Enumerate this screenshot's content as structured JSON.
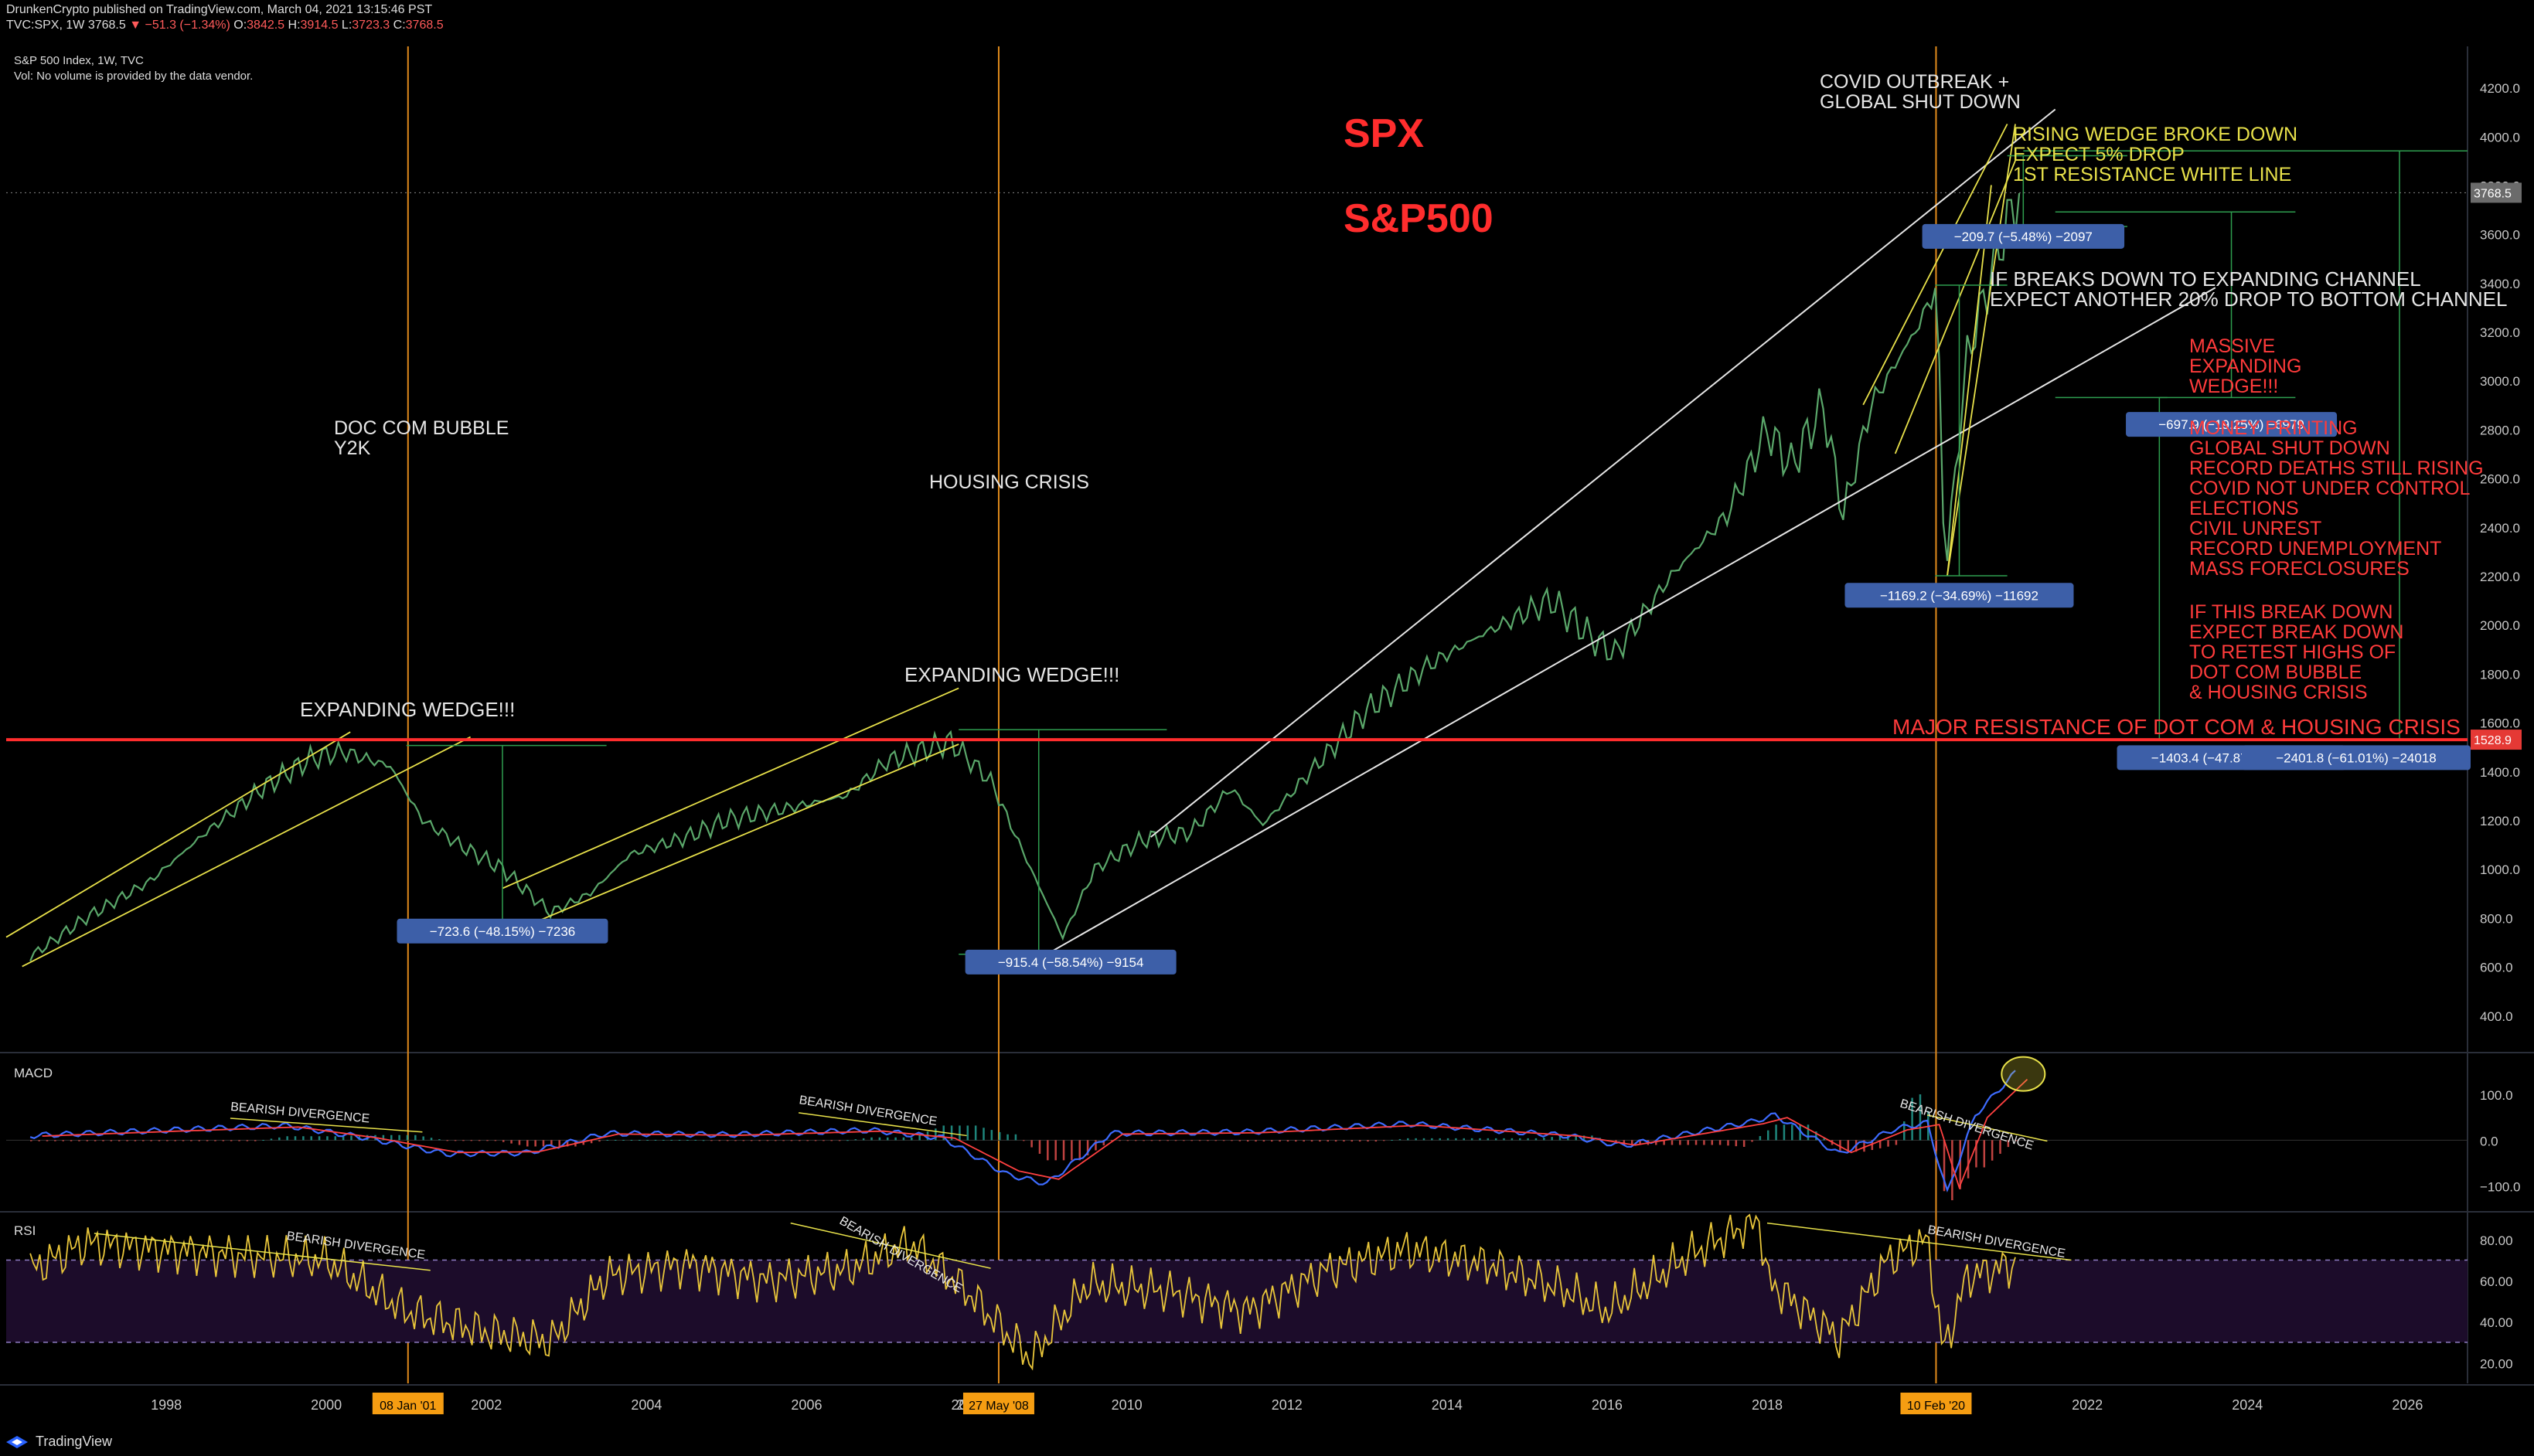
{
  "header": {
    "published": "DrunkenCrypto published on TradingView.com, March 04, 2021 13:15:46 PST",
    "symbol": "TVC:SPX, 1W",
    "last": "3768.5",
    "change": "−51.3 (−1.34%)",
    "o_label": "O:",
    "o": "3842.5",
    "h_label": "H:",
    "h": "3914.5",
    "l_label": "L:",
    "l": "3723.3",
    "c_label": "C:",
    "c": "3768.5",
    "index_title": "S&P 500 Index, 1W, TVC",
    "vol_note": "Vol: No volume is provided by the data vendor."
  },
  "footer": {
    "brand": "TradingView"
  },
  "colors": {
    "background": "#000000",
    "white": "#e6e6e6",
    "yellow": "#e8e14a",
    "red": "#ff2d2d",
    "orange": "#e08a1c",
    "green": "#2e9e4f",
    "macd": "#3d6bff",
    "signal": "#ff4040",
    "rsi": "#e8c53a",
    "label_bg": "#3d5fa8"
  },
  "chart_data": [
    {
      "type": "line",
      "panel": "price",
      "series": [
        {
          "x": [
            1996.3,
            1997.0,
            1997.8,
            1998.5,
            1999.2,
            1999.8,
            2000.2,
            2000.8,
            2001.2,
            2001.7,
            2002.2,
            2002.8,
            2003.3,
            2003.8,
            2004.5,
            2005.0,
            2005.8,
            2006.5,
            2007.0,
            2007.8,
            2008.3,
            2008.8,
            2009.2,
            2009.6,
            2010.2,
            2010.8,
            2011.3,
            2011.7,
            2012.3,
            2013.0,
            2013.8,
            2014.5,
            2015.3,
            2015.8,
            2016.1,
            2016.8,
            2017.5,
            2018.0,
            2018.3,
            2018.7,
            2018.95,
            2019.3,
            2019.9,
            2020.12,
            2020.22,
            2020.5,
            2020.9,
            2021.15
          ],
          "values": [
            640,
            800,
            950,
            1150,
            1330,
            1450,
            1480,
            1420,
            1200,
            1090,
            1000,
            820,
            900,
            1060,
            1130,
            1200,
            1250,
            1300,
            1440,
            1520,
            1360,
            1000,
            720,
            1000,
            1120,
            1150,
            1330,
            1180,
            1400,
            1650,
            1840,
            1970,
            2100,
            1950,
            1880,
            2200,
            2450,
            2800,
            2650,
            2900,
            2450,
            2900,
            3230,
            3390,
            2200,
            3100,
            3550,
            3768.5
          ]
        }
      ],
      "xlim": [
        1996.0,
        2026.75
      ],
      "ylim": [
        260,
        4330
      ],
      "x_ticks": [
        "1998",
        "2000",
        "2002",
        "2004",
        "2006",
        "2008",
        "2010",
        "2012",
        "2014",
        "2016",
        "2018",
        "2020",
        "2022",
        "2024",
        "2026"
      ],
      "x_tick_values": [
        1998,
        2000,
        2002,
        2004,
        2006,
        2008,
        2010,
        2012,
        2014,
        2016,
        2018,
        2020,
        2022,
        2024,
        2026
      ],
      "y_ticks": [
        "400.0",
        "600.0",
        "800.0",
        "1000.0",
        "1200.0",
        "1400.0",
        "1600.0",
        "1800.0",
        "2000.0",
        "2200.0",
        "2400.0",
        "2600.0",
        "2800.0",
        "3000.0",
        "3200.0",
        "3400.0",
        "3600.0",
        "3800.0",
        "4000.0",
        "4200.0"
      ],
      "y_tick_values": [
        400,
        600,
        800,
        1000,
        1200,
        1400,
        1600,
        1800,
        2000,
        2200,
        2400,
        2600,
        2800,
        3000,
        3200,
        3400,
        3600,
        3800,
        4000,
        4200
      ],
      "last_price_label": "3768.5",
      "resistance_price_label": "1528.9",
      "resistance_level": 1528.9,
      "event_lines": [
        {
          "x": 2001.02,
          "label": "08 Jan '01"
        },
        {
          "x": 2008.4,
          "label": "27 May '08"
        },
        {
          "x": 2020.11,
          "label": "10 Feb '20"
        }
      ],
      "x_edge_label": "2",
      "range_labels": [
        {
          "text": "−723.6 (−48.15%) −7236",
          "x": 2002.2,
          "y": 745
        },
        {
          "text": "−915.4 (−58.54%) −9154",
          "x": 2009.3,
          "y": 618
        },
        {
          "text": "−1169.2 (−34.69%) −11692",
          "x": 2020.4,
          "y": 2120
        },
        {
          "text": "−209.7 (−5.48%) −2097",
          "x": 2021.2,
          "y": 3590
        },
        {
          "text": "−697.9 (−19.25%) −6979",
          "x": 2023.8,
          "y": 2820
        },
        {
          "text": "−1403.4 (−47.87%) −14034",
          "x": 2023.8,
          "y": 1455
        },
        {
          "text": "−2401.8 (−61.01%) −24018",
          "x": 2026.8,
          "y": 1455
        }
      ],
      "annotations": {
        "spx": "SPX",
        "sp500": "S&P500",
        "dotcom_1": "DOC COM BUBBLE",
        "dotcom_2": "Y2K",
        "housing": "HOUSING CRISIS",
        "wedge_left": "EXPANDING WEDGE!!!",
        "wedge_mid": "EXPANDING WEDGE!!!",
        "covid_1": "COVID OUTBREAK +",
        "covid_2": "GLOBAL SHUT DOWN",
        "rising_1": "RISING WEDGE BROKE DOWN",
        "rising_2": "EXPECT 5% DROP",
        "rising_3": "1ST RESISTANCE WHITE LINE",
        "breaks_1": "IF BREAKS DOWN TO EXPANDING CHANNEL",
        "breaks_2": "EXPECT ANOTHER 20% DROP TO BOTTOM CHANNEL",
        "massive": [
          "MASSIVE",
          "EXPANDING",
          "WEDGE!!!"
        ],
        "reasons": [
          "MONEY PRINTING",
          "GLOBAL SHUT DOWN",
          "RECORD DEATHS STILL RISING",
          "COVID NOT UNDER CONTROL",
          "ELECTIONS",
          "CIVIL UNREST",
          "RECORD UNEMPLOYMENT",
          "MASS FORECLOSURES"
        ],
        "if_break": [
          "IF THIS BREAK DOWN",
          "EXPECT BREAK DOWN",
          "TO RETEST HIGHS OF",
          "DOT COM BUBBLE",
          "& HOUSING CRISIS"
        ],
        "major": "MAJOR RESISTANCE OF DOT COM & HOUSING CRISIS"
      }
    },
    {
      "type": "line",
      "panel": "macd",
      "title": "MACD",
      "series": [
        {
          "x": [
            1996.3,
            1998.0,
            1999.5,
            2000.5,
            2001.5,
            2002.5,
            2003.5,
            2005.0,
            2006.8,
            2007.7,
            2008.5,
            2009.0,
            2009.8,
            2011.5,
            2013.5,
            2015.5,
            2016.2,
            2017.8,
            2018.1,
            2018.9,
            2019.6,
            2020.0,
            2020.25,
            2020.6,
            2021.1
          ],
          "values": [
            10,
            22,
            32,
            5,
            -30,
            -28,
            15,
            12,
            22,
            5,
            -75,
            -95,
            15,
            18,
            36,
            10,
            -12,
            40,
            55,
            -30,
            25,
            38,
            -115,
            55,
            148
          ]
        }
      ],
      "ylim": [
        -150,
        185
      ],
      "y_ticks": [
        "100.0",
        "0.0",
        "−100.0"
      ],
      "y_tick_values": [
        100,
        0,
        -100
      ],
      "annotations": [
        "BEARISH DIVERGENCE",
        "BEARISH DIVERGENCE",
        "BEARISH DIVERGENCE"
      ]
    },
    {
      "type": "line",
      "panel": "rsi",
      "title": "RSI",
      "series": [
        {
          "x": [
            1996.3,
            1997.0,
            1998.0,
            1999.0,
            2000.0,
            2001.0,
            2002.0,
            2002.8,
            2003.5,
            2004.5,
            2005.5,
            2006.5,
            2007.3,
            2008.0,
            2008.8,
            2009.5,
            2010.5,
            2011.5,
            2012.5,
            2013.5,
            2014.5,
            2015.5,
            2016.0,
            2017.0,
            2017.9,
            2018.0,
            2018.9,
            2019.5,
            2020.0,
            2020.2,
            2020.5,
            2021.1
          ],
          "values": [
            65,
            78,
            75,
            72,
            70,
            45,
            35,
            30,
            62,
            68,
            60,
            65,
            78,
            55,
            22,
            58,
            55,
            45,
            65,
            75,
            68,
            55,
            45,
            72,
            90,
            60,
            32,
            70,
            80,
            25,
            62,
            68
          ]
        }
      ],
      "ylim": [
        10,
        92
      ],
      "y_ticks": [
        "80.00",
        "60.00",
        "40.00",
        "20.00"
      ],
      "y_tick_values": [
        80,
        60,
        40,
        20
      ],
      "levels": [
        70,
        30
      ],
      "annotations": [
        "BEARISH DIVERGENCE",
        "BEARISH DIVERGENCE",
        "BEARISH DIVERGENCE"
      ]
    }
  ]
}
